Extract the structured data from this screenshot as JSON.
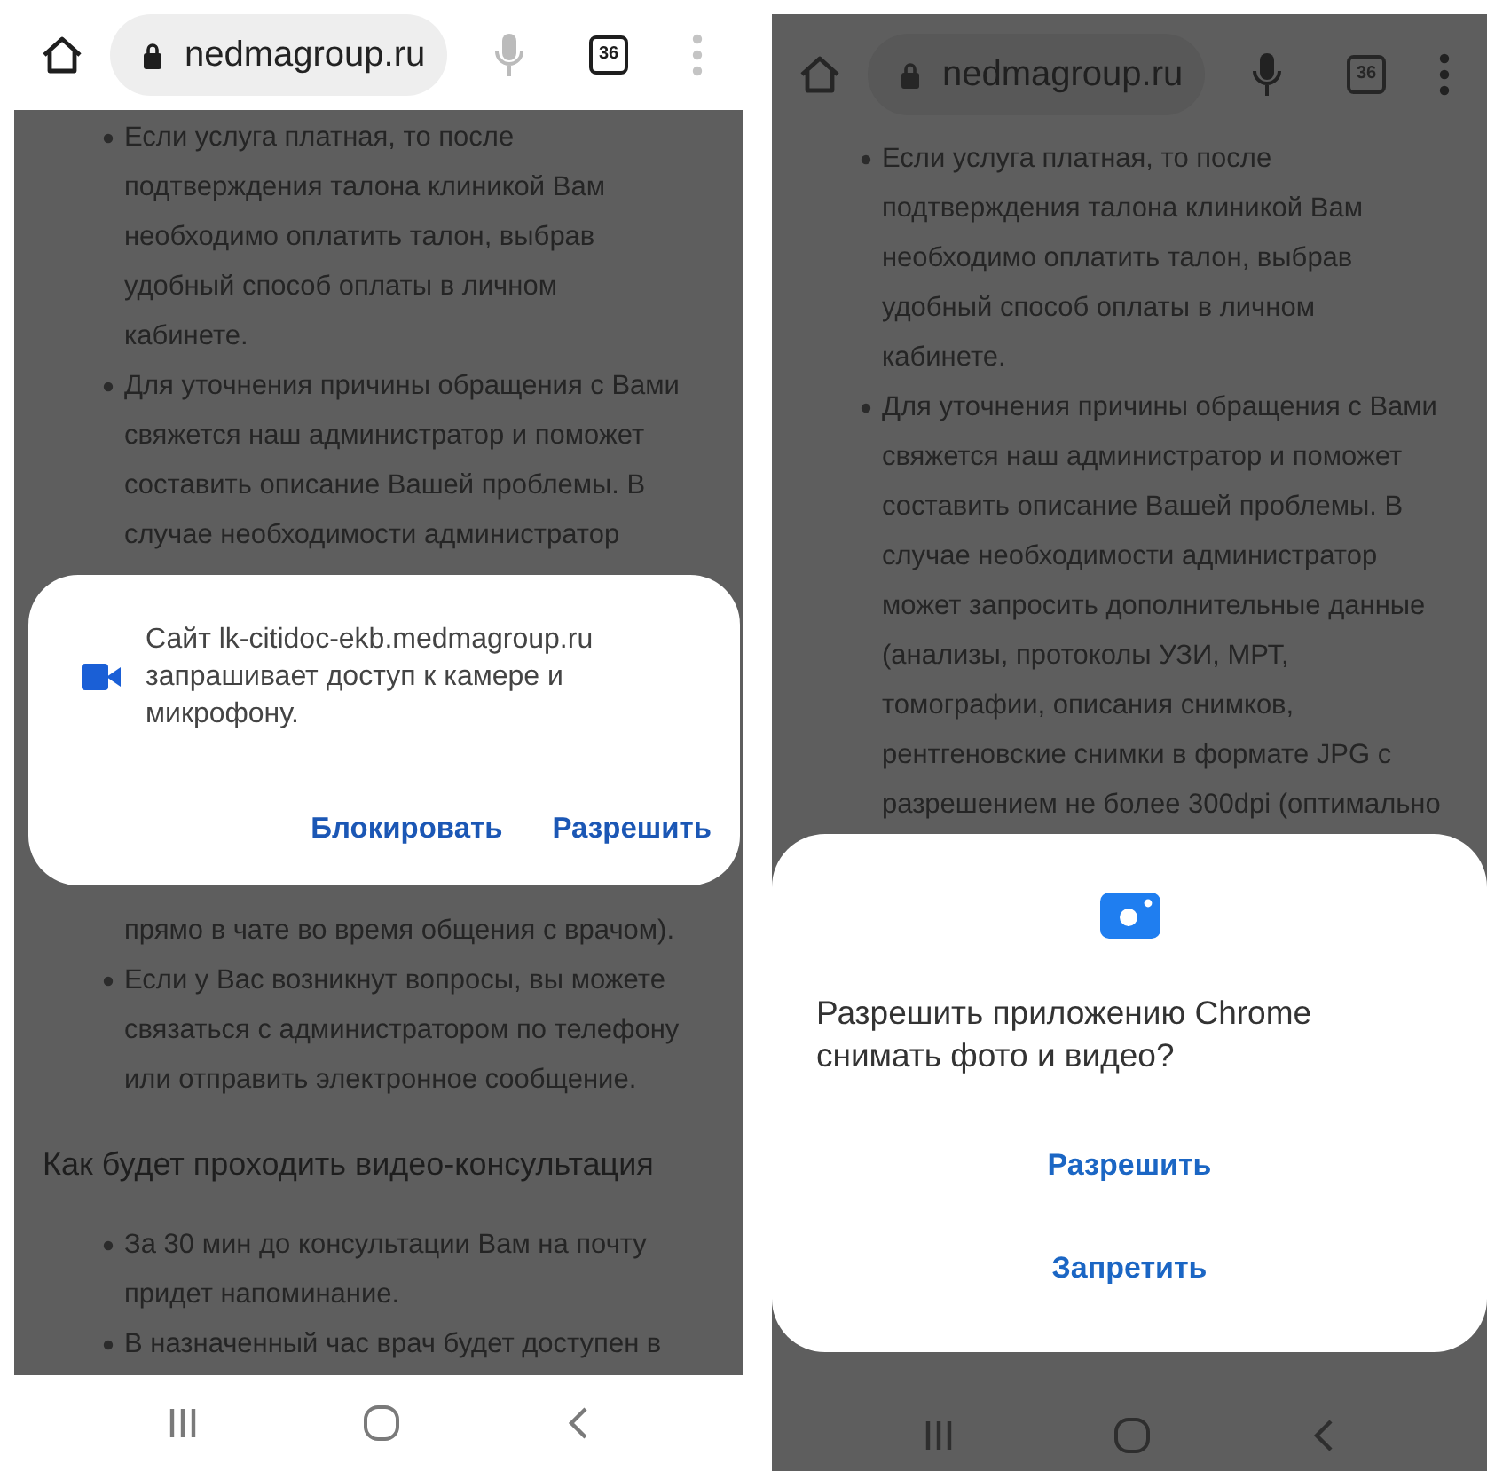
{
  "screens": [
    {
      "dimmed": false,
      "toolbar": {
        "url": "nedmagroup.ru",
        "tab_count": "36"
      },
      "content": [
        {
          "kind": "bullet",
          "lines": [
            "Если услуга платная, то после",
            "подтверждения талона клиникой Вам",
            "необходимо оплатить талон, выбрав",
            "удобный способ оплаты в личном",
            "кабинете."
          ]
        },
        {
          "kind": "bullet",
          "lines": [
            "Для уточнения причины обращения с Вами",
            "свяжется наш администратор и поможет",
            "составить описание Вашей проблемы. В",
            "случае необходимости администратор"
          ]
        },
        {
          "kind": "continuation",
          "lines": [
            "прямо в чате во время общения с врачом)."
          ]
        },
        {
          "kind": "bullet",
          "lines": [
            "Если у Вас возникнут вопросы, вы можете",
            "связаться с администратором по телефону",
            "или отправить электронное сообщение."
          ]
        },
        {
          "kind": "heading",
          "lines": [
            "Как будет проходить видео-консультация"
          ]
        },
        {
          "kind": "bullet",
          "lines": [
            "За 30 мин до консультации Вам на почту",
            "придет напоминание."
          ]
        },
        {
          "kind": "bullet",
          "lines": [
            "В назначенный час врач будет доступен в"
          ]
        }
      ],
      "dialog": {
        "kind": "site_permission",
        "lines": [
          "Сайт lk-citidoc-ekb.medmagroup.ru",
          "запрашивает доступ к камере и",
          "микрофону."
        ],
        "buttons": [
          "Блокировать",
          "Разрешить"
        ]
      }
    },
    {
      "dimmed": true,
      "toolbar": {
        "url": "nedmagroup.ru",
        "tab_count": "36"
      },
      "content": [
        {
          "kind": "bullet",
          "lines": [
            "Если услуга платная, то после",
            "подтверждения талона клиникой Вам",
            "необходимо оплатить талон, выбрав",
            "удобный способ оплаты в личном",
            "кабинете."
          ]
        },
        {
          "kind": "bullet",
          "lines": [
            "Для уточнения причины обращения с Вами",
            "свяжется наш администратор и поможет",
            "составить описание Вашей проблемы. В",
            "случае необходимости администратор",
            "может запросить дополнительные данные",
            "(анализы, протоколы УЗИ, МРТ,",
            "томографии, описания снимков,",
            "рентгеновские снимки в формате JPG с",
            "разрешением не более 300dpi (оптимально"
          ]
        }
      ],
      "dialog": {
        "kind": "app_permission",
        "lines": [
          "Разрешить приложению Chrome",
          "снимать фото и видео?"
        ],
        "buttons": [
          "Разрешить",
          "Запретить"
        ]
      }
    }
  ]
}
